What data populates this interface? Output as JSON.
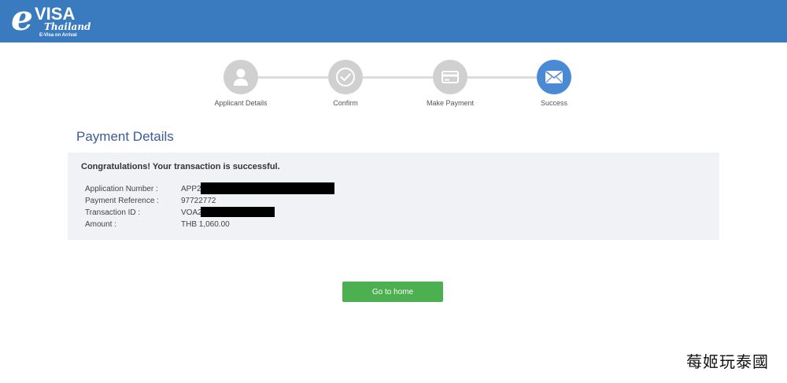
{
  "header": {
    "logo": {
      "e": "e",
      "visa": "VISA",
      "country": "Thailand",
      "tagline": "E-Visa on Arrival"
    },
    "background_color": "#3a7bbf"
  },
  "stepper": {
    "steps": [
      {
        "label": "Applicant Details",
        "icon": "person-icon",
        "state": "completed"
      },
      {
        "label": "Confirm",
        "icon": "check-circle-icon",
        "state": "completed"
      },
      {
        "label": "Make Payment",
        "icon": "credit-card-icon",
        "state": "completed"
      },
      {
        "label": "Success",
        "icon": "envelope-icon",
        "state": "active"
      }
    ],
    "active_color": "#4a8ad4",
    "inactive_color": "#d0d0d0"
  },
  "payment": {
    "title": "Payment Details",
    "message": "Congratulations! Your transaction is successful.",
    "fields": [
      {
        "label": "Application Number :",
        "value": "APP2"
      },
      {
        "label": "Payment Reference :",
        "value": "97722772"
      },
      {
        "label": "Transaction ID :",
        "value": "VOA2"
      },
      {
        "label": "Amount :",
        "value": "THB 1,060.00"
      }
    ]
  },
  "actions": {
    "home_label": "Go to home",
    "button_color": "#4cb050"
  },
  "watermark": "莓姬玩泰國"
}
